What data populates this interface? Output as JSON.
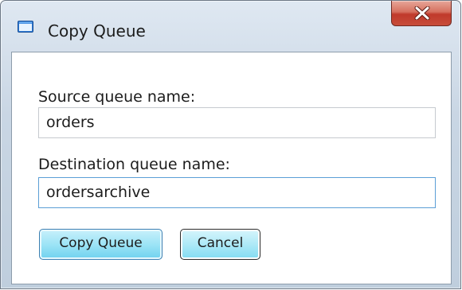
{
  "window": {
    "title": "Copy Queue",
    "icon": "app-window-icon",
    "close_icon": "close-icon",
    "close_color": "#c74d3a"
  },
  "form": {
    "source_label": "Source queue name:",
    "source_value": "orders",
    "destination_label": "Destination queue name:",
    "destination_value": "ordersarchive"
  },
  "buttons": {
    "copy_label": "Copy Queue",
    "cancel_label": "Cancel"
  },
  "colors": {
    "accent_button": "#9de4f6",
    "focus_border": "#5b9fd6"
  }
}
